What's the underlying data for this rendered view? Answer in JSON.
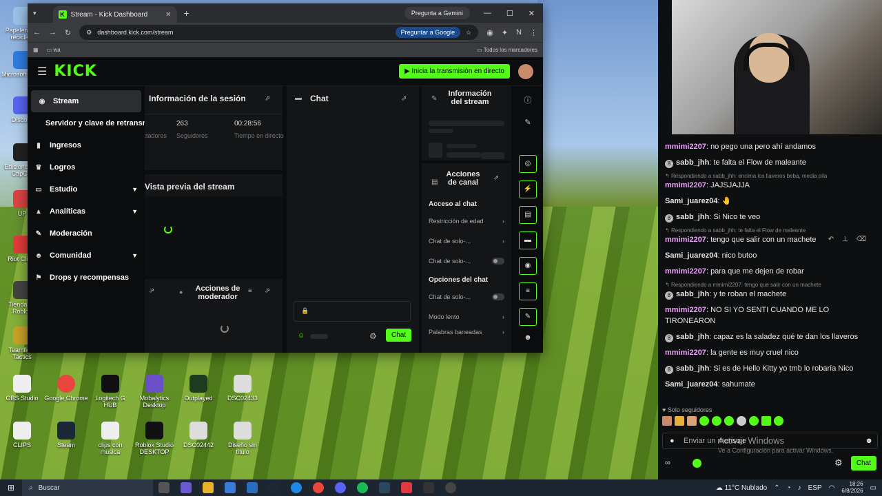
{
  "browser": {
    "tab_title": "Stream - Kick Dashboard",
    "gemini_label": "Pregunta a Gemini",
    "url": "dashboard.kick.com/stream",
    "google_btn": "Preguntar a Google",
    "bookmark_folder": "wa",
    "all_bookmarks": "Todos los marcadores",
    "profile_initial": "N"
  },
  "kick": {
    "logo": "KICK",
    "go_live": "Inicia la transmisión en directo",
    "nav": [
      {
        "label": "Stream"
      },
      {
        "label": "Servidor y clave de retransmisión"
      },
      {
        "label": "Ingresos"
      },
      {
        "label": "Logros"
      },
      {
        "label": "Estudio"
      },
      {
        "label": "Analíticas"
      },
      {
        "label": "Moderación"
      },
      {
        "label": "Comunidad"
      },
      {
        "label": "Drops y recompensas"
      }
    ],
    "session": {
      "title": "Información de la sesión",
      "followers_value": "263",
      "followers_label": "Seguidores",
      "viewers_label": "Espectadores",
      "time_value": "00:28:56",
      "time_label": "Tiempo en directo"
    },
    "stream_panel_title": "Vista previa del stream",
    "mod_actions": "Acciones de moderador",
    "chat_title": "Chat",
    "chat_send": "Chat",
    "info_title": "Información del stream",
    "channel_actions": "Acciones de canal",
    "access": {
      "title": "Acceso al chat",
      "rows": [
        "Restricción de edad",
        "Chat de solo-...",
        "Chat de solo-..."
      ]
    },
    "options": {
      "title": "Opciones del chat",
      "rows": [
        "Chat de solo-...",
        "Modo lento",
        "Palabras baneadas"
      ]
    }
  },
  "desktop_icons": [
    "Papelera de reciclaje",
    "Microsoft Edge",
    "Discord",
    "Ediciones de CapCut",
    "UP",
    "Riot Client",
    "Tienda de Roblox",
    "Teamfight Tactics",
    "OBS Studio",
    "Google Chrome",
    "Logitech G HUB",
    "Mobalytics Desktop",
    "Outplayed",
    "DSC02433",
    "CLIPS",
    "Steam",
    "clips con musica",
    "Roblox Studio DESKTOP",
    "DSC02442",
    "Diseño sin título"
  ],
  "stream_chat": {
    "messages": [
      {
        "reply": "",
        "user": "mmimi2207",
        "text": "no pego una pero ahí andamos",
        "badge": false
      },
      {
        "reply": "",
        "user": "sabb_jhh",
        "text": "te falta el Flow de maleante",
        "badge": true
      },
      {
        "reply": "Respondiendo a sabb_jhh: encima los llaveros beba, media pila",
        "user": "mmimi2207",
        "text": "JAJSJAJJA",
        "badge": false
      },
      {
        "reply": "",
        "user": "Sami_juarez04",
        "text": "🤚",
        "badge": false
      },
      {
        "reply": "",
        "user": "sabb_jhh",
        "text": "Si Nico te veo",
        "badge": true
      },
      {
        "reply": "Respondiendo a sabb_jhh: te falta el Flow de maleante",
        "user": "mmimi2207",
        "text": "tengo que salir con un machete",
        "badge": false
      },
      {
        "reply": "",
        "user": "Sami_juarez04",
        "text": "nico butoo",
        "badge": false
      },
      {
        "reply": "",
        "user": "mmimi2207",
        "text": "para que me dejen de robar",
        "badge": false
      },
      {
        "reply": "Respondiendo a mmimi2207: tengo que salir con un machete",
        "user": "sabb_jhh",
        "text": "y te roban el machete",
        "badge": true
      },
      {
        "reply": "",
        "user": "mmimi2207",
        "text": "NO SI YO SENTI CUANDO ME LO TIRONEARON",
        "badge": false
      },
      {
        "reply": "",
        "user": "sabb_jhh",
        "text": "capaz es la saladez qué te dan los llaveros",
        "badge": true
      },
      {
        "reply": "",
        "user": "mmimi2207",
        "text": "la gente es muy cruel nico",
        "badge": false
      },
      {
        "reply": "",
        "user": "sabb_jhh",
        "text": "Si es de Hello Kitty yo tmb lo robaría Nico",
        "badge": true
      },
      {
        "reply": "",
        "user": "Sami_juarez04",
        "text": "sahumate",
        "badge": false
      }
    ],
    "followers_only": "Solo seguidores",
    "input_placeholder": "Enviar un mensaje",
    "send_label": "Chat",
    "watermark_title": "Activar Windows",
    "watermark_sub": "Ve a Configuración para activar Windows."
  },
  "taskbar": {
    "search": "Buscar",
    "weather": "11°C  Nublado",
    "lang": "ESP",
    "time": "18:26",
    "date": "6/8/2026"
  }
}
